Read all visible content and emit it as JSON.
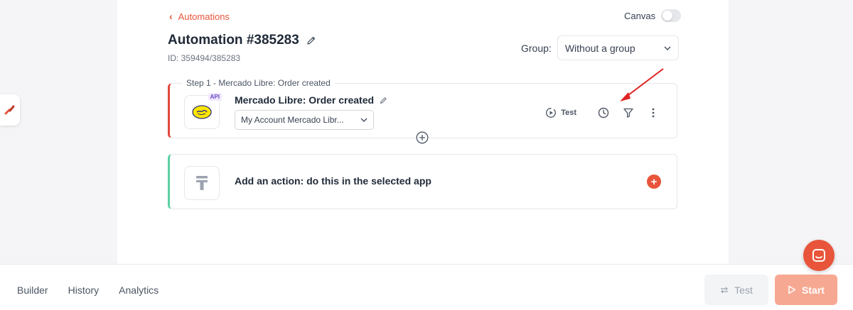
{
  "header": {
    "back_label": "Automations",
    "canvas_label": "Canvas",
    "canvas_on": false,
    "title": "Automation #385283",
    "id_text": "ID: 359494/385283",
    "group_label": "Group:",
    "group_value": "Without a group"
  },
  "steps": {
    "step1_label": "Step 1 - Mercado Libre: Order created",
    "trigger_title": "Mercado Libre: Order created",
    "api_badge": "API",
    "account_value": "My Account Mercado Libr...",
    "test_label": "Test",
    "icons": [
      "play-circle-icon",
      "clock-icon",
      "filter-icon",
      "more-vertical-icon"
    ]
  },
  "action": {
    "text": "Add an action: do this in the selected app",
    "add_icon": "plus-icon"
  },
  "bottombar": {
    "tabs": [
      "Builder",
      "History",
      "Analytics"
    ],
    "test_button": "Test",
    "start_button": "Start"
  },
  "colors": {
    "accent": "#e8553a",
    "trigger_border": "#e04a3a",
    "action_border": "#5bd0a3",
    "annotation_arrow": "#e02424"
  }
}
